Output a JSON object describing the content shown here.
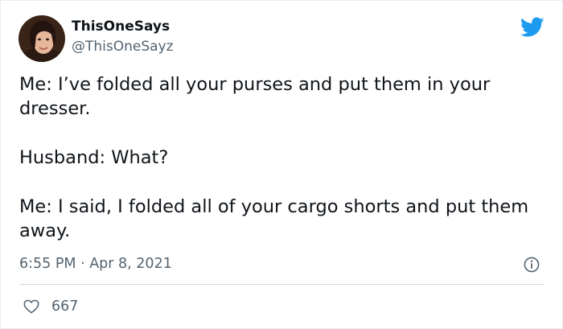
{
  "author": {
    "display_name": "ThisOneSays",
    "handle": "@ThisOneSayz",
    "avatar_icon": "profile-photo"
  },
  "tweet": {
    "lines": [
      "Me: I’ve folded all your purses and put them in your dresser.",
      "Husband: What?",
      "Me: I said, I folded all of your cargo shorts and put them away."
    ],
    "timestamp": "6:55 PM · Apr 8, 2021"
  },
  "engagement": {
    "likes": "667"
  },
  "icons": {
    "brand": "twitter-bird-icon",
    "info": "info-icon",
    "like": "heart-icon"
  },
  "colors": {
    "brand_blue": "#1d9bf0",
    "text": "#0f1419",
    "muted": "#536471"
  }
}
